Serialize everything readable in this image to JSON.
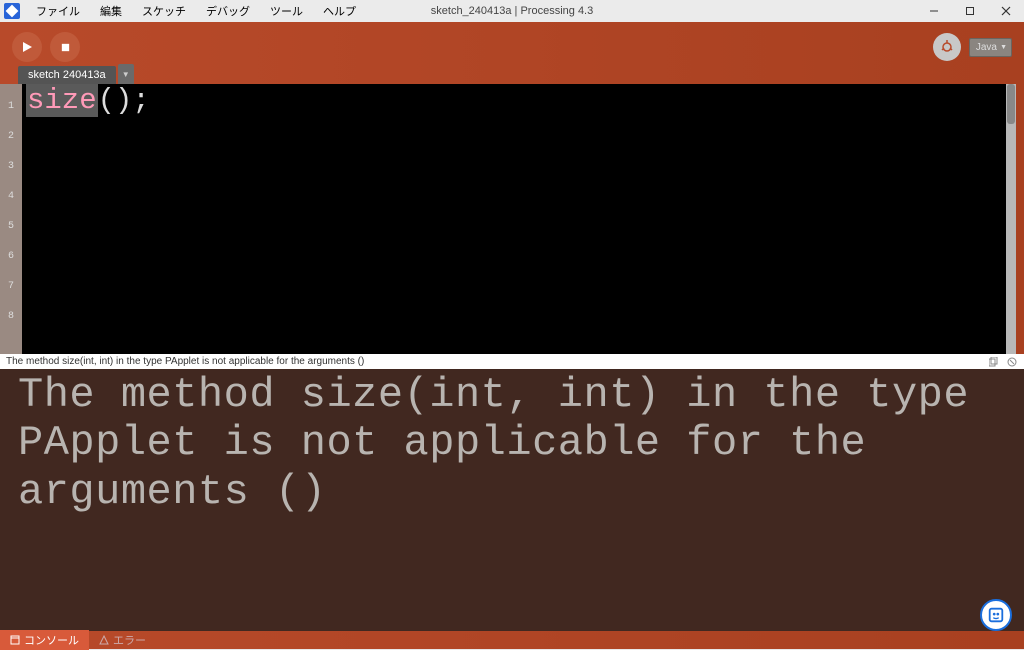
{
  "title": "sketch_240413a | Processing 4.3",
  "menus": [
    "ファイル",
    "編集",
    "スケッチ",
    "デバッグ",
    "ツール",
    "ヘルプ"
  ],
  "mode": "Java",
  "tab": "sketch 240413a",
  "gutter": [
    "1",
    "2",
    "3",
    "4",
    "5",
    "6",
    "7",
    "8"
  ],
  "code": {
    "func": "size",
    "rest": "();"
  },
  "status": "The method size(int, int) in the type PApplet is not applicable for the arguments ()",
  "console_text": "The method size(int, int) in the type PApplet is not applicable for the arguments ()",
  "bottom": {
    "console": "コンソール",
    "errors": "エラー"
  }
}
